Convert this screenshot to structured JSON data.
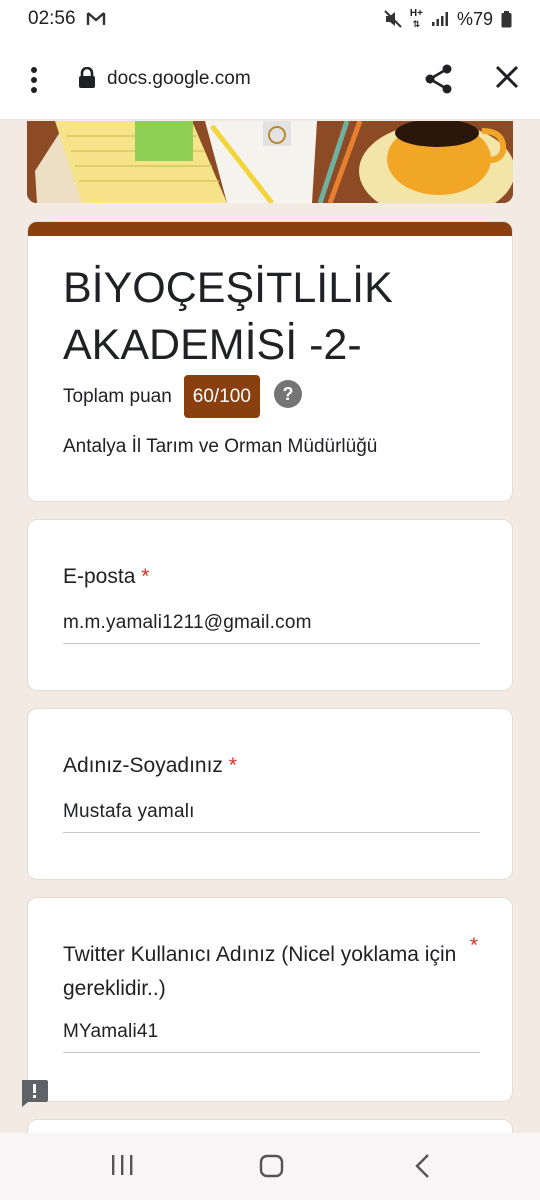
{
  "status_bar": {
    "time": "02:56",
    "network_label": "H+",
    "battery": "%79"
  },
  "browser": {
    "url": "docs.google.com"
  },
  "form": {
    "title": "BİYOÇEŞİTLİLİK AKADEMİSİ -2-",
    "score_label": "Toplam puan",
    "score_value": "60/100",
    "subtitle": "Antalya İl Tarım ve Orman Müdürlüğü",
    "theme_color": "#8a3f0f"
  },
  "questions": [
    {
      "label": "E-posta",
      "required_mark": "*",
      "value": "m.m.yamali1211@gmail.com"
    },
    {
      "label": "Adınız-Soyadınız",
      "required_mark": "*",
      "value": "Mustafa yamalı"
    },
    {
      "label": "Twitter Kullanıcı Adınız (Nicel yoklama için gereklidir..)",
      "required_mark": "*",
      "value": "MYamali41"
    }
  ],
  "icons": {
    "menu": "more-vert-icon",
    "lock": "lock-icon",
    "share": "share-icon",
    "close": "close-icon",
    "help": "help-icon",
    "feedback": "feedback-icon"
  }
}
